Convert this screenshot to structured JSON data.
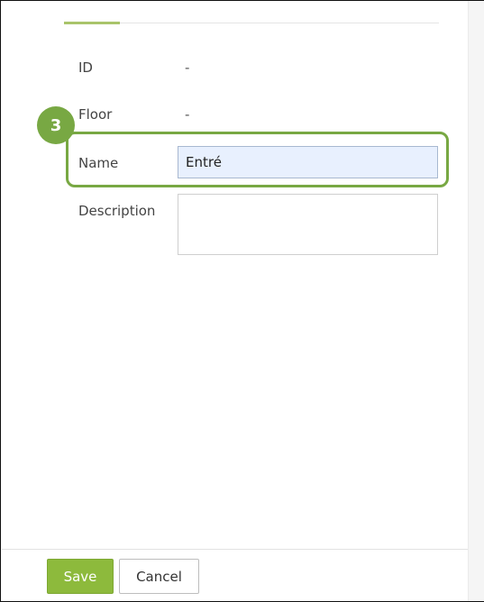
{
  "form": {
    "fields": {
      "id": {
        "label": "ID",
        "value": "-"
      },
      "floor": {
        "label": "Floor",
        "value": "-"
      },
      "name": {
        "label": "Name",
        "value": "Entré"
      },
      "description": {
        "label": "Description",
        "value": ""
      }
    }
  },
  "annotation": {
    "step_number": "3",
    "color": "#78a843"
  },
  "footer": {
    "save_label": "Save",
    "cancel_label": "Cancel"
  },
  "colors": {
    "save_button": "#8dba3c",
    "active_tab_underline": "#a9c46a",
    "name_input_background": "#e8f0fe"
  }
}
